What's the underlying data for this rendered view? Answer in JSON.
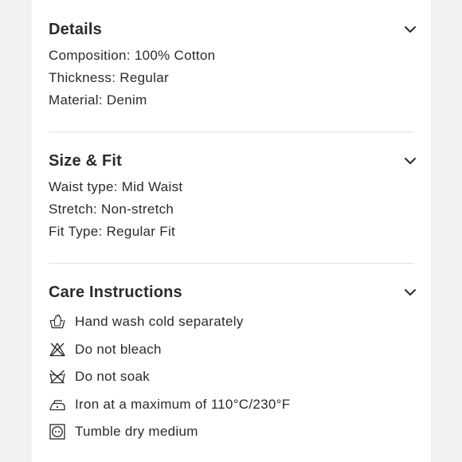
{
  "sections": [
    {
      "title": "Details",
      "lines": [
        "Composition: 100% Cotton",
        "Thickness: Regular",
        "Material: Denim"
      ]
    },
    {
      "title": "Size & Fit",
      "lines": [
        "Waist type: Mid Waist",
        "Stretch: Non-stretch",
        "Fit Type: Regular Fit"
      ]
    },
    {
      "title": "Care Instructions",
      "care": [
        {
          "icon": "hand-wash-icon",
          "label": "Hand wash cold separately"
        },
        {
          "icon": "do-not-bleach-icon",
          "label": "Do not bleach"
        },
        {
          "icon": "do-not-soak-icon",
          "label": "Do not soak"
        },
        {
          "icon": "iron-icon",
          "label": "Iron at a maximum of 110°C/230°F"
        },
        {
          "icon": "tumble-dry-icon",
          "label": "Tumble dry medium"
        }
      ]
    }
  ]
}
